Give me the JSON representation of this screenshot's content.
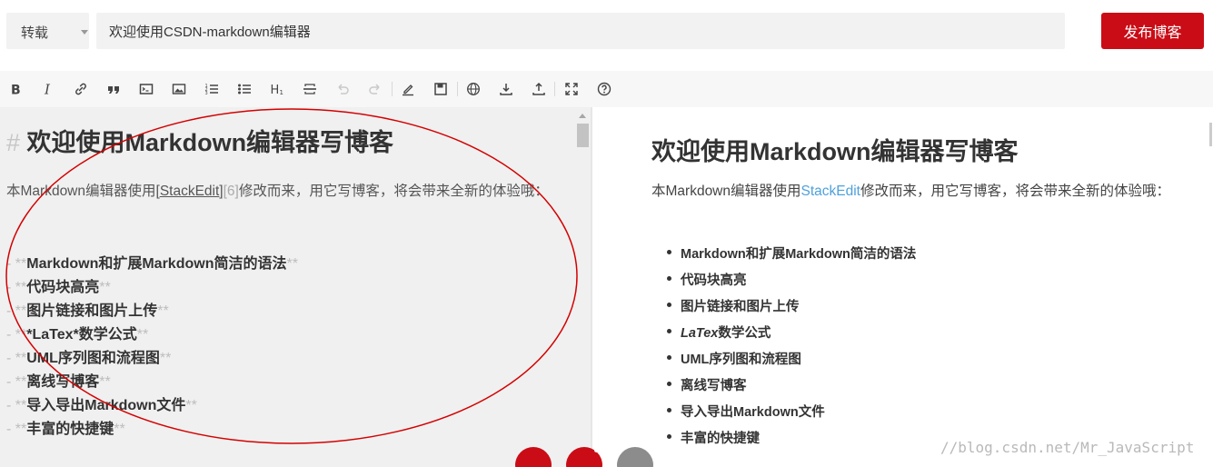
{
  "header": {
    "article_type": "转载",
    "title_value": "欢迎使用CSDN-markdown编辑器",
    "publish_label": "发布博客"
  },
  "toolbar": {
    "icons": [
      "bold-icon",
      "italic-icon",
      "link-icon",
      "quote-icon",
      "code-icon",
      "image-icon",
      "ordered-list-icon",
      "unordered-list-icon",
      "heading-icon",
      "hr-icon",
      "undo-icon",
      "redo-icon",
      "pen-icon",
      "save-draft-icon",
      "globe-icon",
      "download-icon",
      "upload-icon",
      "fullscreen-icon",
      "help-icon"
    ]
  },
  "editor": {
    "heading_mark": "#",
    "heading": "欢迎使用Markdown编辑器写博客",
    "para_before": "本Markdown编辑器使用",
    "para_link_open": "[",
    "para_link": "StackEdit",
    "para_link_close": "]",
    "para_ref": "[6]",
    "para_after": "修改而来，用它写博客，将会带来全新的体验哦：",
    "item_prefix": "- **",
    "item_suffix": "**",
    "items": [
      "Markdown和扩展Markdown简洁的语法",
      "代码块高亮",
      "图片链接和图片上传",
      "*LaTex*数学公式",
      "UML序列图和流程图",
      "离线写博客",
      "导入导出Markdown文件",
      "丰富的快捷键"
    ]
  },
  "preview": {
    "heading": "欢迎使用Markdown编辑器写博客",
    "para_before": "本Markdown编辑器使用",
    "para_link": "StackEdit",
    "para_after": "修改而来，用它写博客，将会带来全新的体验哦：",
    "items": [
      "Markdown和扩展Markdown简洁的语法",
      "代码块高亮",
      "图片链接和图片上传",
      "数学公式",
      "UML序列图和流程图",
      "离线写博客",
      "导入导出Markdown文件",
      "丰富的快捷键"
    ],
    "latex_word": "LaTex"
  },
  "watermark": "//blog.csdn.net/Mr_JavaScript",
  "colors": {
    "publish": "#ca0c16",
    "link": "#4ea1db",
    "annotation": "#d40000"
  }
}
